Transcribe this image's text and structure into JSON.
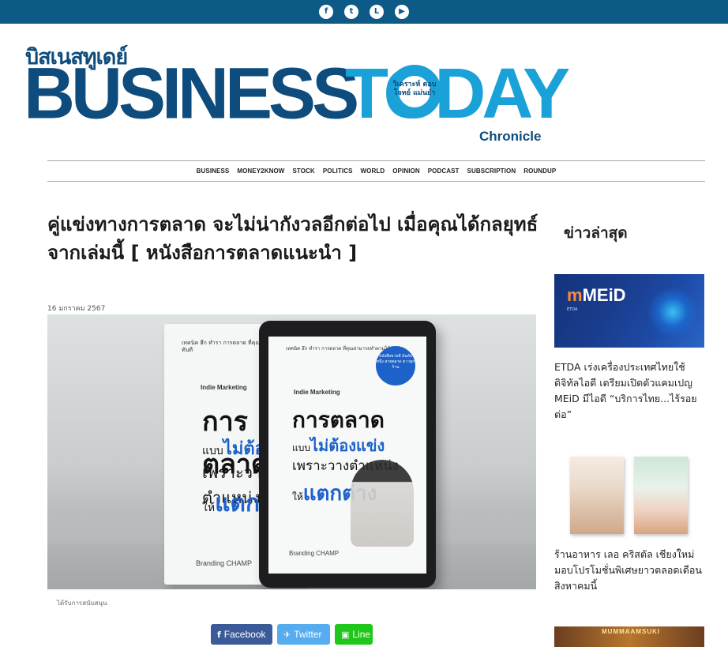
{
  "topbar": {
    "social": [
      {
        "icon": "facebook-icon",
        "glyph": "f"
      },
      {
        "icon": "twitter-icon",
        "glyph": "t"
      },
      {
        "icon": "line-icon",
        "glyph": "L"
      },
      {
        "icon": "youtube-icon",
        "glyph": "▶"
      }
    ],
    "bg_color": "#0d5a86"
  },
  "logo": {
    "thai": "บิสเนสทูเดย์",
    "business": "BUSINESS",
    "today": "TODAY",
    "ring_text": "วิเคราะห์ ตอบโจทย์ แม่นยำ",
    "chronicle": "Chronicle",
    "colors": {
      "dark": "#0d4c7d",
      "light": "#1aa1d8"
    }
  },
  "nav": {
    "items": [
      "BUSINESS",
      "MONEY2KNOW",
      "STOCK",
      "POLITICS",
      "WORLD",
      "OPINION",
      "PODCAST",
      "SUBSCRIPTION",
      "ROUNDUP"
    ]
  },
  "article": {
    "headline": "คู่แข่งทางการตลาด จะไม่น่ากังวลอีกต่อไป เมื่อคุณได้กลยุทธ์จากเล่มนี้ [ หนังสือการตลาดแนะนำ ]",
    "date": "16 มกราคม 2567",
    "caption": "ได้รับการสนับสนุน",
    "hero": {
      "book_lines": "เทคนิค ฮึก ทำรา การตลาด\nที่คุณสามารถทำตามได้ทันที",
      "indie": "Indie Marketing",
      "title1": "การตลาด",
      "title2_pre": "แบบ",
      "title2_em": "ไม่ต้องแข่ง",
      "title3": "เพราะวางตำแหน่ง",
      "title4_pre": "ให้",
      "title4_em": "แตกต่าง",
      "brand": "Branding CHAMP",
      "badge": "หนังสือขายดี อันดับหนึ่ง สายตลาด ตาวทุกร้าน"
    }
  },
  "share": {
    "facebook": "Facebook",
    "twitter": "Twitter",
    "line": "Line",
    "colors": {
      "facebook": "#3b5a98",
      "twitter": "#55acee",
      "line": "#1ec71a"
    }
  },
  "sidebar": {
    "title": "ข่าวล่าสุด",
    "items": [
      {
        "text": "ETDA เร่งเครื่องประเทศไทยใช้ดิจิทัลไอดี เตรียมเปิดตัวแคมเปญ MEiD มีไอดี “บริการไทย...ไร้รอยต่อ”",
        "img_label": "MEiD",
        "img_label_pre": "m",
        "img_sub": "ETDA"
      },
      {
        "text": "ร้านอาหาร เลอ คริสตัล เชียงใหม่ มอบโปรโมชั่นพิเศษยาวตลอดเดือนสิงหาคมนี้"
      },
      {
        "img_label": "MUMMAAMSUKI"
      }
    ]
  }
}
